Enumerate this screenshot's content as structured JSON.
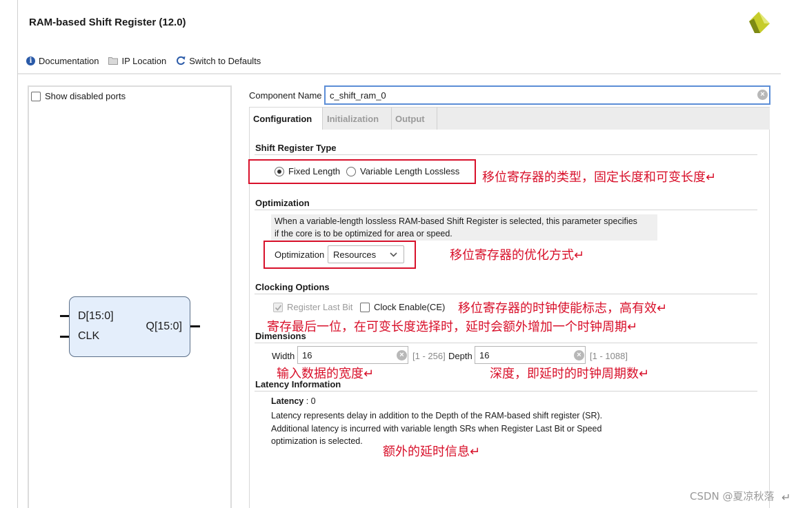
{
  "header": {
    "title": "RAM-based Shift Register (12.0)"
  },
  "toolbar": {
    "documentation": "Documentation",
    "ip_location": "IP Location",
    "switch_defaults": "Switch to Defaults"
  },
  "left_panel": {
    "show_disabled_ports": "Show disabled ports",
    "block": {
      "port_d": "D[15:0]",
      "port_clk": "CLK",
      "port_q": "Q[15:0]"
    }
  },
  "component": {
    "label": "Component Name",
    "value": "c_shift_ram_0"
  },
  "tabs": [
    {
      "label": "Configuration",
      "active": true
    },
    {
      "label": "Initialization",
      "active": false
    },
    {
      "label": "Output",
      "active": false
    }
  ],
  "shift_register_type": {
    "title": "Shift Register Type",
    "option_fixed": "Fixed Length",
    "option_variable": "Variable Length Lossless",
    "selected": "Fixed Length"
  },
  "optimization": {
    "title": "Optimization",
    "description_line1": "When a variable-length lossless RAM-based Shift Register is selected, this parameter specifies",
    "description_line2": "if the core is to be optimized for area or speed.",
    "label": "Optimization",
    "value": "Resources"
  },
  "clocking": {
    "title": "Clocking Options",
    "register_last_bit": "Register Last Bit",
    "register_last_bit_checked": true,
    "clock_enable": "Clock Enable(CE)",
    "clock_enable_checked": false
  },
  "dimensions": {
    "title": "Dimensions",
    "width_label": "Width",
    "width_value": "16",
    "width_range": "[1 - 256]",
    "depth_label": "Depth",
    "depth_value": "16",
    "depth_range": "[1 - 1088]"
  },
  "latency": {
    "title": "Latency Information",
    "label": "Latency",
    "value": ": 0",
    "desc_line1": "Latency represents delay in addition to the Depth of the RAM-based shift register (SR).",
    "desc_line2": "Additional latency is incurred with variable length SRs when Register Last Bit or Speed",
    "desc_line3": "optimization is selected."
  },
  "annotations": {
    "type_note": "移位寄存器的类型，固定长度和可变长度↵",
    "opt_note": "移位寄存器的优化方式↵",
    "ce_note": "移位寄存器的时钟使能标志，高有效↵",
    "last_bit_note": "寄存最后一位，在可变长度选择时，延时会额外增加一个时钟周期↵",
    "width_note": "输入数据的宽度↵",
    "depth_note": "深度，即延时的时钟周期数↵",
    "latency_note": "额外的延时信息↵"
  },
  "watermark": "CSDN @夏凉秋落",
  "return_mark": "↵",
  "colors": {
    "annotation_red": "#d8102a",
    "focus_blue": "#5b8dd6",
    "block_fill": "#e4eefb"
  }
}
